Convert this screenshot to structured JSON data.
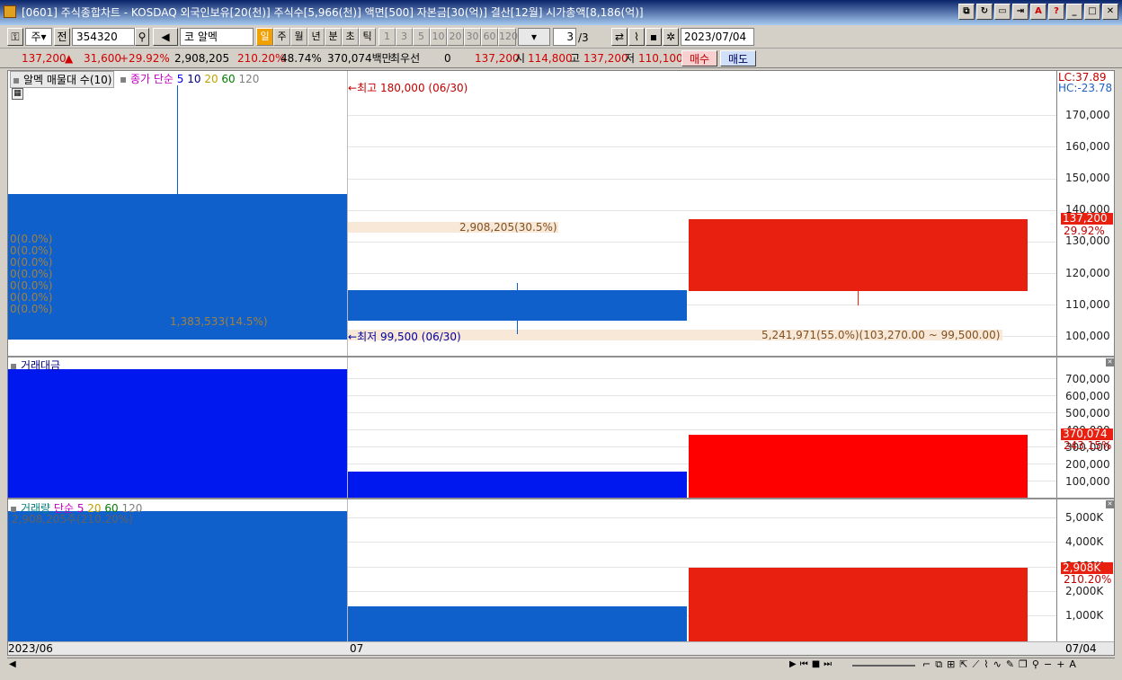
{
  "window": {
    "title": "[0601] 주식종합차트 - KOSDAQ 외국인보유[20(천)] 주식수[5,966(천)] 액면[500] 자본금[30(억)] 결산[12월] 시가총액[8,186(억)]"
  },
  "toolbar": {
    "market": "주",
    "prev": "전",
    "code": "354320",
    "stock_name": "코 알멕",
    "periods": [
      "일",
      "주",
      "월",
      "년",
      "분",
      "초",
      "틱"
    ],
    "intervals": [
      "1",
      "3",
      "5",
      "10",
      "20",
      "30",
      "60",
      "120"
    ],
    "page": "3",
    "page_total": "/3",
    "date": "2023/07/04"
  },
  "quote": {
    "price": "137,200",
    "change": "31,600",
    "rate": "+29.92%",
    "volume": "2,908,205",
    "vol_ratio": "210.20%",
    "turnover": "48.74%",
    "amount": "370,074백만",
    "best": "최우선",
    "best_val": "0",
    "ask": "137,200",
    "open_lbl": "시",
    "open": "114,800",
    "high_lbl": "고",
    "high": "137,200",
    "low_lbl": "저",
    "low": "110,100",
    "buy": "매수",
    "sell": "매도"
  },
  "price_pane": {
    "legend_profile": "알멕 매물대 수(10)",
    "legend_ma_title": "종가 단순",
    "ma": [
      {
        "label": "5",
        "color": "#0000ff"
      },
      {
        "label": "10",
        "color": "#000080"
      },
      {
        "label": "20",
        "color": "#c0a000"
      },
      {
        "label": "60",
        "color": "#008000"
      },
      {
        "label": "120",
        "color": "#808080"
      }
    ],
    "lc": "LC:37.89",
    "hc": "HC:-23.78",
    "high_note": "최고 180,000 (06/30)",
    "low_note": "최저 99,500 (06/30)",
    "zero_labels": [
      "0(0.0%)",
      "0(0.0%)",
      "0(0.0%)",
      "0(0.0%)",
      "0(0.0%)",
      "0(0.0%)",
      "0(0.0%)"
    ],
    "profile_a": "1,383,533(14.5%)",
    "profile_b": "2,908,205(30.5%)",
    "profile_c": "5,241,971(55.0%)(103,270.00 ~ 99,500.00)",
    "axis": [
      "170,000",
      "160,000",
      "150,000",
      "140,000",
      "130,000",
      "120,000",
      "110,000",
      "100,000"
    ],
    "cur_price": "137,200",
    "cur_rate": "29.92%"
  },
  "amount_pane": {
    "legend": "거래대금",
    "axis": [
      "700,000",
      "600,000",
      "500,000",
      "400,000",
      "300,000",
      "200,000",
      "100,000"
    ],
    "cur": "370,074",
    "cur_rate": "243.15%"
  },
  "volume_pane": {
    "legend": "거래량",
    "legend_ma_title": "단순",
    "ma": [
      {
        "label": "5",
        "color": "#c000c0"
      },
      {
        "label": "20",
        "color": "#c0a000"
      },
      {
        "label": "60",
        "color": "#008000"
      },
      {
        "label": "120",
        "color": "#808080"
      }
    ],
    "note": "2,908,205주(210.20%)",
    "axis": [
      "5,000K",
      "4,000K",
      "3,000K",
      "2,000K",
      "1,000K"
    ],
    "cur": "2,908K",
    "cur_rate": "210.20%"
  },
  "xaxis": {
    "left": "2023/06",
    "mid": "07",
    "right": "07/04"
  }
}
